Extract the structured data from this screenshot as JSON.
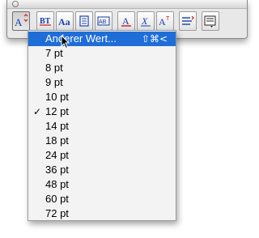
{
  "toolbar": {
    "buttons": [
      {
        "name": "font-size-button",
        "icon": "font-size-icon"
      },
      {
        "name": "text-style-button",
        "icon": "text-style-icon"
      },
      {
        "name": "character-format-button",
        "icon": "character-format-icon"
      },
      {
        "name": "document-button",
        "icon": "document-icon"
      },
      {
        "name": "text-frame-button",
        "icon": "text-frame-icon"
      },
      {
        "name": "underline-button",
        "icon": "underline-icon"
      },
      {
        "name": "italic-button",
        "icon": "italic-icon"
      },
      {
        "name": "superscript-button",
        "icon": "superscript-icon"
      },
      {
        "name": "list-button",
        "icon": "list-icon"
      },
      {
        "name": "more-button",
        "icon": "dropdown-icon"
      }
    ]
  },
  "menu": {
    "items": [
      {
        "label": "Anderer Wert...",
        "shortcut": "⇧⌘<",
        "highlighted": true,
        "checked": false
      },
      {
        "label": "7 pt"
      },
      {
        "label": "8 pt"
      },
      {
        "label": "9 pt"
      },
      {
        "label": "10 pt"
      },
      {
        "label": "12 pt",
        "checked": true
      },
      {
        "label": "14 pt"
      },
      {
        "label": "18 pt"
      },
      {
        "label": "24 pt"
      },
      {
        "label": "36 pt"
      },
      {
        "label": "48 pt"
      },
      {
        "label": "60 pt"
      },
      {
        "label": "72 pt"
      }
    ],
    "check_mark": "✓"
  },
  "colors": {
    "highlight": "#1f6ed8",
    "accent_red": "#d01818",
    "accent_blue": "#1a3fb0"
  }
}
